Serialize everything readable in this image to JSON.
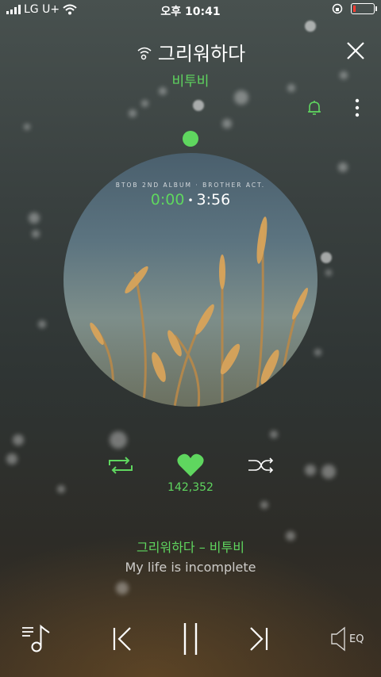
{
  "status_bar": {
    "carrier": "LG U+",
    "time": "오후 10:41"
  },
  "header": {
    "song_title": "그리워하다",
    "artist": "비투비"
  },
  "album": {
    "label": "BTOB 2ND ALBUM · BROTHER ACT.",
    "current_time": "0:00",
    "separator": "•",
    "total_time": "3:56"
  },
  "controls": {
    "like_count": "142,352",
    "eq_label": "EQ"
  },
  "lyrics": {
    "song_line": "그리워하다 – 비투비",
    "current_line": "My life is incomplete"
  },
  "colors": {
    "accent": "#5fd65f",
    "battery_low": "#ff3b30"
  },
  "icons": {
    "close": "close-icon",
    "bell": "bell-icon",
    "more": "more-vertical-icon",
    "repeat": "repeat-icon",
    "heart": "heart-icon",
    "shuffle": "shuffle-icon",
    "playlist": "playlist-icon",
    "previous": "previous-icon",
    "pause": "pause-icon",
    "next": "next-icon",
    "equalizer": "equalizer-icon"
  }
}
